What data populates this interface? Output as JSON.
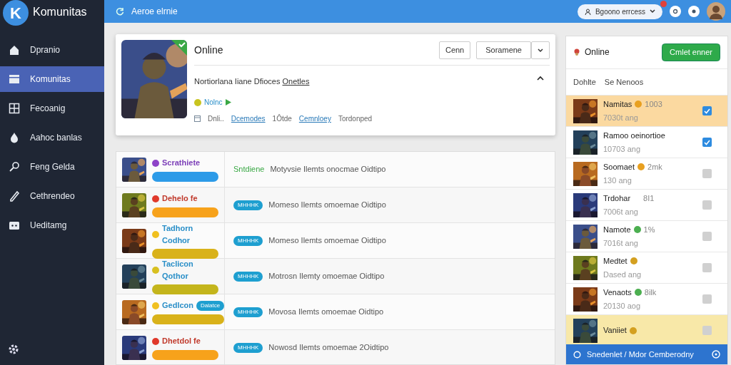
{
  "brand": {
    "logo_letter": "K",
    "name": "Komunitas"
  },
  "sidebar": {
    "items": [
      {
        "label": "Dpranio",
        "selected": false
      },
      {
        "label": "Komunitas",
        "selected": true
      },
      {
        "label": "Fecoanig",
        "selected": false
      },
      {
        "label": "Aahoc banlas",
        "selected": false
      },
      {
        "label": "Feng Gelda",
        "selected": false
      },
      {
        "label": "Cethrendeo",
        "selected": false
      },
      {
        "label": "Ueditamg",
        "selected": false
      }
    ]
  },
  "topbar": {
    "title": "Aeroe elrnie",
    "account": "Bgoono errcess"
  },
  "feature": {
    "title": "Online",
    "buttons": [
      "Cenn",
      "Soramene"
    ],
    "headline": "Nortiorlana Iiane Dfioces",
    "headline_link": "Onetles",
    "status": "Nolnc",
    "meta": [
      {
        "text": "Dnli..",
        "link": false
      },
      {
        "text": "Dcemodes",
        "link": true
      },
      {
        "text": "1Ôtde",
        "link": false
      },
      {
        "text": "Cemnloey",
        "link": true
      },
      {
        "text": "Tordonped",
        "link": false
      }
    ]
  },
  "feed": [
    {
      "title": {
        "text": "Scrathiete",
        "color": "#7c3fb8"
      },
      "dot": {
        "color": "#8e44c8"
      },
      "bar": {
        "color": "#2d9be8"
      },
      "tag": {
        "kind": "text",
        "text": "Sntdiene"
      },
      "text": "Motyvsie Ilemts onocmae Oidtipo"
    },
    {
      "title": {
        "text": "Dehelo fe",
        "color": "#c0392b"
      },
      "dot": {
        "color": "#e0392b"
      },
      "bar": {
        "color": "#f7a21b"
      },
      "tag": {
        "kind": "pill",
        "text": "MHHHK"
      },
      "text": "Momeso Ilemts omoemae Oidtipo"
    },
    {
      "title": {
        "text": "Tadhorn Codhor",
        "color": "#2a8fc8"
      },
      "dot": {
        "color": "#f0c020"
      },
      "bar": {
        "color": "#d9b21a"
      },
      "tag": {
        "kind": "pill",
        "text": "MHHHK"
      },
      "text": "Momeso Ilemts omoemae Oidtipo"
    },
    {
      "title": {
        "text": "Taclicon Qothor",
        "color": "#2a8fc8"
      },
      "dot": {
        "color": "#d8c020"
      },
      "bar": {
        "color": "#c4b51c"
      },
      "tag": {
        "kind": "pill",
        "text": "MHHHK"
      },
      "text": "Motrosn Ilemty omoemae Oidtipo"
    },
    {
      "title": {
        "text": "Gedlcon",
        "color": "#2a8fc8"
      },
      "dot": {
        "color": "#f0c020"
      },
      "bar": {
        "color": "#d9b21a"
      },
      "badge": "Dalatce",
      "tag": {
        "kind": "pill",
        "text": "MHHHK"
      },
      "text": "Movosa Ilemts omoemae Oidtipo"
    },
    {
      "title": {
        "text": "Dhetdol fe",
        "color": "#c0392b"
      },
      "dot": {
        "color": "#e0392b"
      },
      "bar": {
        "color": "#f7a21b"
      },
      "tag": {
        "kind": "pill",
        "text": "MHHHK"
      },
      "text": "Nowosd Ilemts omoemae 2Oidtipo"
    }
  ],
  "members": {
    "title": "Online",
    "button": "Cmlet enner",
    "columns": [
      "Dohlte",
      "Se Nenoos"
    ],
    "rows": [
      {
        "name": "Namitas",
        "color": "#e8a020",
        "extra": "1003",
        "sub": "7030t ang",
        "checked": true,
        "selected": true
      },
      {
        "name": "Ramoo oeinortioe",
        "sub": "10703 ang",
        "checked": true,
        "selected": false
      },
      {
        "name": "Soomaet",
        "color": "#e8a020",
        "extra": "2mk",
        "sub": "130 ang",
        "checked": false,
        "selected": false
      },
      {
        "name": "Trdohar",
        "extra": "8I1",
        "sub": "7006t ang",
        "checked": false,
        "selected": false
      },
      {
        "name": "Namote",
        "color": "#4caf50",
        "extra": "1%",
        "sub": "7016t ang",
        "checked": false,
        "selected": false
      },
      {
        "name": "Medtet",
        "color": "#d4a020",
        "sub": "Dased ang",
        "checked": false,
        "selected": false
      },
      {
        "name": "Venaots",
        "color": "#4caf50",
        "extra": "8ilk",
        "sub": "20130 aog",
        "checked": false,
        "selected": false
      },
      {
        "name": "Vaniiet",
        "color": "#d4a020",
        "checked": false,
        "selected": true
      }
    ],
    "footer": "Snedenlet / Mdor Cemberodny"
  }
}
